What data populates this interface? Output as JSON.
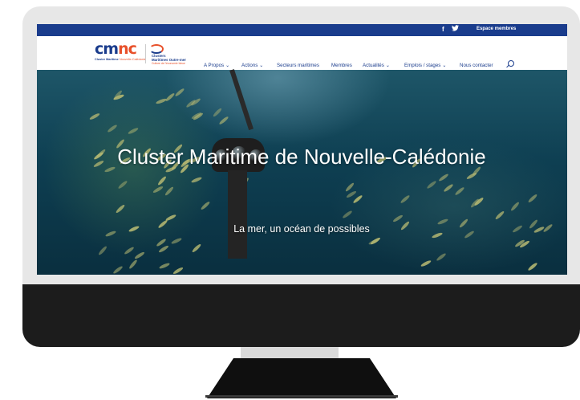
{
  "topbar": {
    "facebook_icon": "f",
    "twitter_icon": "🐦",
    "member_space": "Espace membres"
  },
  "logo": {
    "cmnc_part1": "cm",
    "cmnc_part2": "nc",
    "cmnc_sub_a": "Cluster Maritime",
    "cmnc_sub_b": " Nouvelle-Calédonie",
    "clusters_line1": "Clusters",
    "clusters_line2": "Maritimes Outre-mer",
    "clusters_sub": "Culture de l'économie bleue"
  },
  "nav": {
    "items": [
      {
        "label": "A Propos",
        "dropdown": true
      },
      {
        "label": "Actions",
        "dropdown": true
      },
      {
        "label": "Secteurs maritimes",
        "dropdown": false
      },
      {
        "label": "Membres",
        "dropdown": false
      },
      {
        "label": "Actualités",
        "dropdown": true
      },
      {
        "label": "Emplois / stages",
        "dropdown": true
      },
      {
        "label": "Nous contacter",
        "dropdown": false
      }
    ],
    "chevron": "⌄",
    "search_icon": "search-icon"
  },
  "hero": {
    "title": "Cluster Maritime de Nouvelle-Calédonie",
    "subtitle": "La mer, un océan de possibles"
  },
  "colors": {
    "brand_blue": "#1a3c8c",
    "brand_orange": "#e8502a",
    "ocean": "#0e3f52"
  }
}
